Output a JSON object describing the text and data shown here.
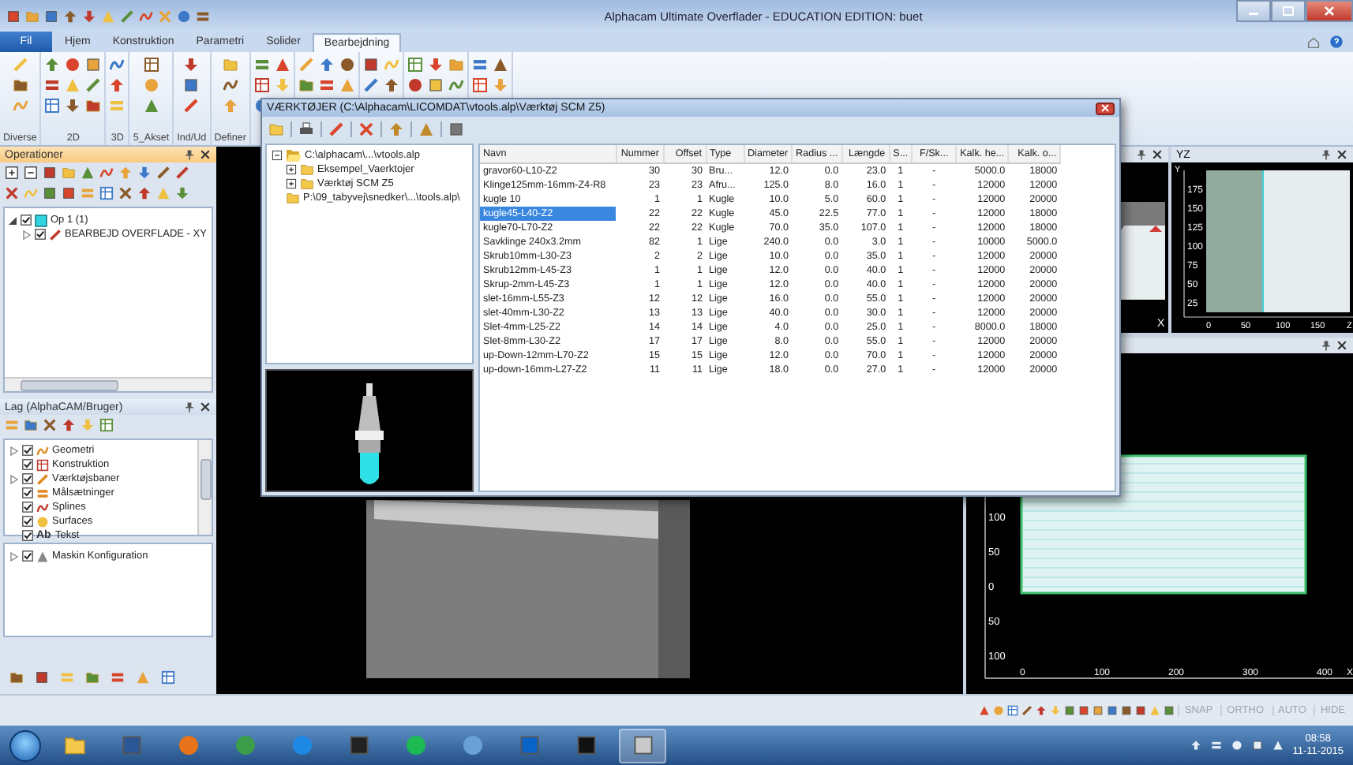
{
  "window": {
    "title": "Alphacam Ultimate Overflader - EDUCATION EDITION: buet"
  },
  "ribbon": {
    "tabs": [
      {
        "label": "Fil",
        "kind": "menu",
        "selected": false
      },
      {
        "label": "Hjem",
        "kind": "tab",
        "selected": false
      },
      {
        "label": "Konstruktion",
        "kind": "tab",
        "selected": false
      },
      {
        "label": "Parametri",
        "kind": "tab",
        "selected": false
      },
      {
        "label": "Solider",
        "kind": "tab",
        "selected": false
      },
      {
        "label": "Bearbejdning",
        "kind": "tab",
        "selected": true
      }
    ],
    "groups": [
      "Diverse",
      "2D",
      "3D",
      "5_Akset",
      "Ind/Ud",
      "Definer"
    ]
  },
  "operations": {
    "title": "Operationer",
    "tree": [
      {
        "label": "Op 1  (1)",
        "checked": true,
        "has_children": true,
        "expanded": true,
        "children": [
          {
            "label": "BEARBEJD OVERFLADE - XY",
            "checked": true,
            "has_children": true,
            "expanded": false
          }
        ]
      }
    ]
  },
  "layers": {
    "title": "Lag (AlphaCAM/Bruger)",
    "items": [
      {
        "label": "Geometri",
        "checked": true,
        "has_children": true
      },
      {
        "label": "Konstruktion",
        "checked": true,
        "has_children": false
      },
      {
        "label": "Værktøjsbaner",
        "checked": true,
        "has_children": true
      },
      {
        "label": "Målsætninger",
        "checked": true,
        "has_children": false
      },
      {
        "label": "Splines",
        "checked": true,
        "has_children": false
      },
      {
        "label": "Surfaces",
        "checked": true,
        "has_children": false
      },
      {
        "label": "Tekst",
        "checked": true,
        "has_children": false,
        "badge": "Ab"
      }
    ]
  },
  "machine": {
    "label": "Maskin Konfiguration",
    "checked": true,
    "has_children": true
  },
  "views": {
    "front": {
      "axis": "X"
    },
    "yz": {
      "title": "YZ",
      "axis_v": "Y",
      "axis_h": "Z",
      "v_ticks": [
        "175",
        "150",
        "125",
        "100",
        "75",
        "50",
        "25"
      ],
      "h_ticks": [
        "0",
        "50",
        "100",
        "150"
      ]
    },
    "plan": {
      "axis_h": "X",
      "v_ticks": [
        "100",
        "50",
        "0",
        "50",
        "100"
      ],
      "h_ticks": [
        "0",
        "100",
        "200",
        "300",
        "400"
      ]
    }
  },
  "tools_dialog": {
    "title": "VÆRKTØJER (C:\\Alphacam\\LICOMDAT\\vtools.alp\\Værktøj SCM Z5)",
    "tree": [
      {
        "label": "C:\\alphacam\\...\\vtools.alp",
        "has_children": true,
        "expanded": true,
        "children": [
          {
            "label": "Eksempel_Vaerktojer",
            "has_children": true,
            "expanded": false
          },
          {
            "label": "Værktøj SCM Z5",
            "has_children": true,
            "expanded": false
          }
        ]
      },
      {
        "label": "P:\\09_tabyvej\\snedker\\...\\tools.alp\\",
        "has_children": false
      }
    ],
    "columns": [
      "Navn",
      "Nummer",
      "Offset",
      "Type",
      "Diameter",
      "Radius ...",
      "Længde",
      "S...",
      "F/Sk...",
      "Kalk. he...",
      "Kalk. o..."
    ],
    "rows": [
      {
        "selected": false,
        "cells": [
          "gravor60-L10-Z2",
          "30",
          "30",
          "Bru...",
          "12.0",
          "0.0",
          "23.0",
          "1",
          "-",
          "5000.0",
          "18000"
        ]
      },
      {
        "selected": false,
        "cells": [
          "Klinge125mm-16mm-Z4-R8",
          "23",
          "23",
          "Afru...",
          "125.0",
          "8.0",
          "16.0",
          "1",
          "-",
          "12000",
          "12000"
        ]
      },
      {
        "selected": false,
        "cells": [
          "kugle 10",
          "1",
          "1",
          "Kugle",
          "10.0",
          "5.0",
          "60.0",
          "1",
          "-",
          "12000",
          "20000"
        ]
      },
      {
        "selected": true,
        "cells": [
          "kugle45-L40-Z2",
          "22",
          "22",
          "Kugle",
          "45.0",
          "22.5",
          "77.0",
          "1",
          "-",
          "12000",
          "18000"
        ]
      },
      {
        "selected": false,
        "cells": [
          "kugle70-L70-Z2",
          "22",
          "22",
          "Kugle",
          "70.0",
          "35.0",
          "107.0",
          "1",
          "-",
          "12000",
          "18000"
        ]
      },
      {
        "selected": false,
        "cells": [
          "Savklinge 240x3.2mm",
          "82",
          "1",
          "Lige",
          "240.0",
          "0.0",
          "3.0",
          "1",
          "-",
          "10000",
          "5000.0"
        ]
      },
      {
        "selected": false,
        "cells": [
          "Skrub10mm-L30-Z3",
          "2",
          "2",
          "Lige",
          "10.0",
          "0.0",
          "35.0",
          "1",
          "-",
          "12000",
          "20000"
        ]
      },
      {
        "selected": false,
        "cells": [
          "Skrub12mm-L45-Z3",
          "1",
          "1",
          "Lige",
          "12.0",
          "0.0",
          "40.0",
          "1",
          "-",
          "12000",
          "20000"
        ]
      },
      {
        "selected": false,
        "cells": [
          "Skrup-2mm-L45-Z3",
          "1",
          "1",
          "Lige",
          "12.0",
          "0.0",
          "40.0",
          "1",
          "-",
          "12000",
          "20000"
        ]
      },
      {
        "selected": false,
        "cells": [
          "slet-16mm-L55-Z3",
          "12",
          "12",
          "Lige",
          "16.0",
          "0.0",
          "55.0",
          "1",
          "-",
          "12000",
          "20000"
        ]
      },
      {
        "selected": false,
        "cells": [
          "slet-40mm-L30-Z2",
          "13",
          "13",
          "Lige",
          "40.0",
          "0.0",
          "30.0",
          "1",
          "-",
          "12000",
          "20000"
        ]
      },
      {
        "selected": false,
        "cells": [
          "Slet-4mm-L25-Z2",
          "14",
          "14",
          "Lige",
          "4.0",
          "0.0",
          "25.0",
          "1",
          "-",
          "8000.0",
          "18000"
        ]
      },
      {
        "selected": false,
        "cells": [
          "Slet-8mm-L30-Z2",
          "17",
          "17",
          "Lige",
          "8.0",
          "0.0",
          "55.0",
          "1",
          "-",
          "12000",
          "20000"
        ]
      },
      {
        "selected": false,
        "cells": [
          "up-Down-12mm-L70-Z2",
          "15",
          "15",
          "Lige",
          "12.0",
          "0.0",
          "70.0",
          "1",
          "-",
          "12000",
          "20000"
        ]
      },
      {
        "selected": false,
        "cells": [
          "up-down-16mm-L27-Z2",
          "11",
          "11",
          "Lige",
          "18.0",
          "0.0",
          "27.0",
          "1",
          "-",
          "12000",
          "20000"
        ]
      }
    ]
  },
  "status_bar": {
    "toggles": [
      "SNAP",
      "ORTHO",
      "AUTO",
      "HIDE"
    ]
  },
  "taskbar": {
    "time": "08:58",
    "date": "11-11-2015"
  }
}
